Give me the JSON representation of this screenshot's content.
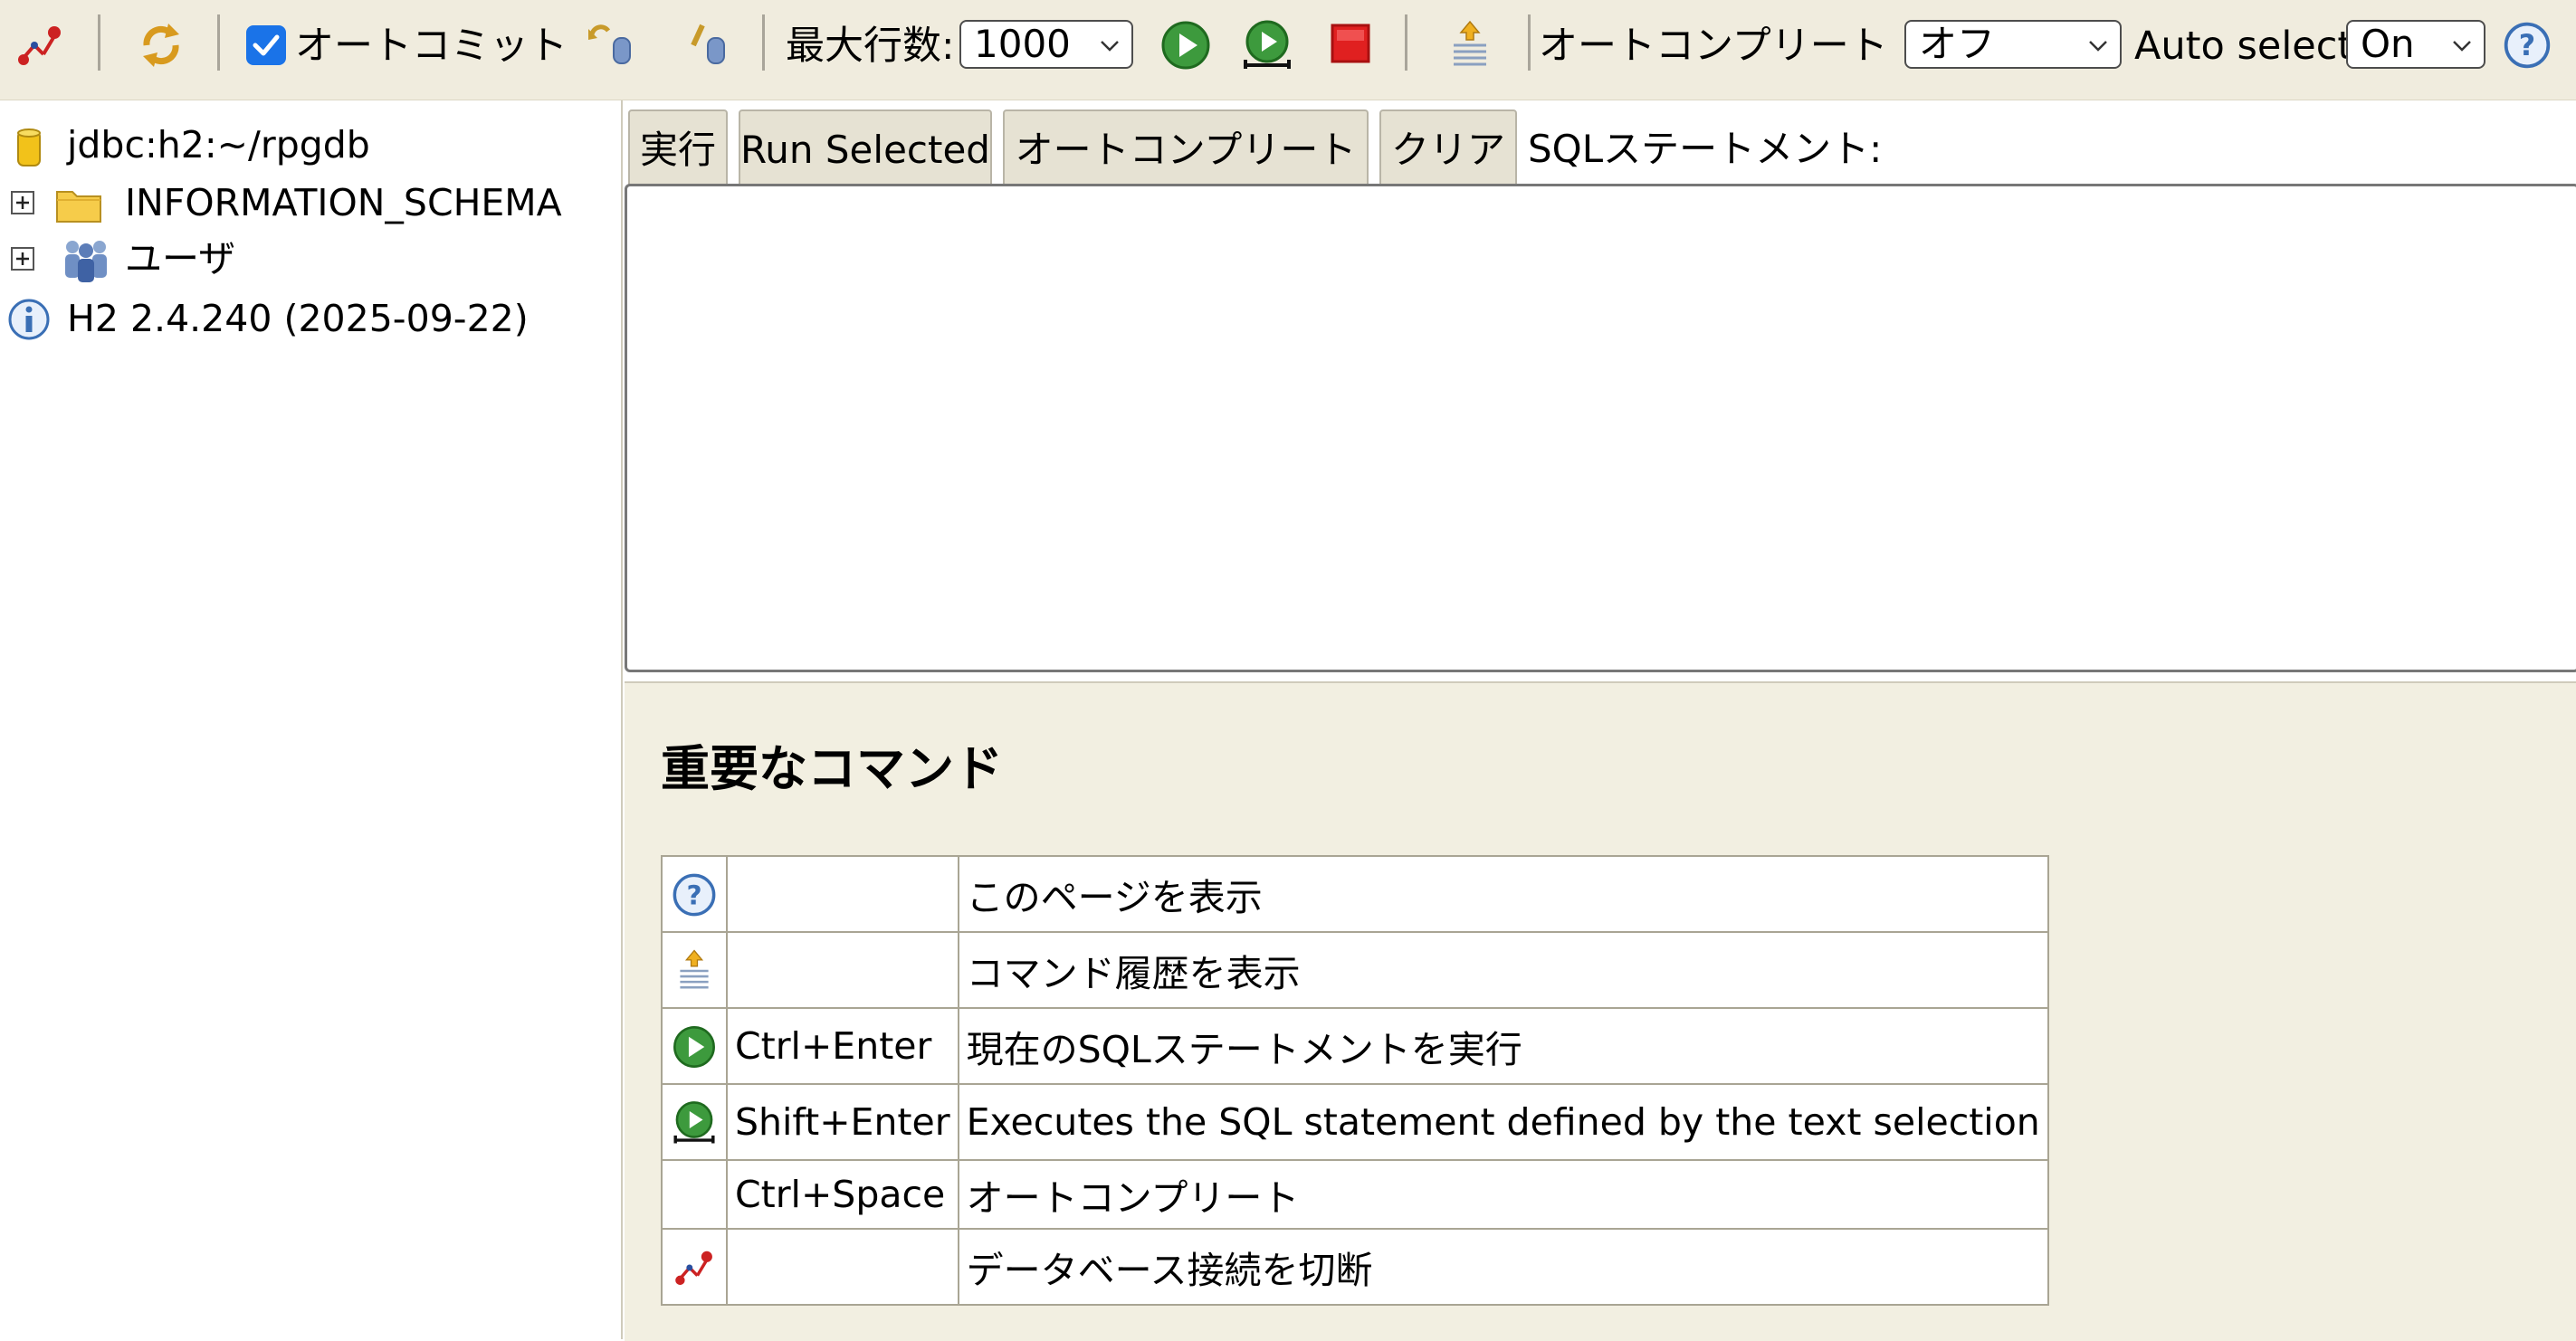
{
  "toolbar": {
    "disconnect_icon": "disconnect-icon",
    "refresh_icon": "refresh-icon",
    "autocommit_checked": true,
    "autocommit_label": "オートコミット",
    "rollback_icon": "rollback-icon",
    "commit_icon": "commit-icon",
    "max_rows_label": "最大行数:",
    "max_rows_value": "1000",
    "run_icon": "run-icon",
    "run_selected_icon": "run-selected-icon",
    "stop_icon": "stop-icon",
    "history_icon": "history-icon",
    "autocomplete_label": "オートコンプリート",
    "autocomplete_value": "オフ",
    "auto_select_label": "Auto select",
    "auto_select_value": "On",
    "help_icon": "help-icon"
  },
  "tree": {
    "connection": "jdbc:h2:~/rpgdb",
    "items": [
      {
        "label": "INFORMATION_SCHEMA",
        "icon": "folder-icon"
      },
      {
        "label": "ユーザ",
        "icon": "users-icon"
      }
    ],
    "version": "H2 2.4.240 (2025-09-22)"
  },
  "editor": {
    "run_label": "実行",
    "run_selected_label": "Run Selected",
    "autocomplete_label": "オートコンプリート",
    "clear_label": "クリア",
    "statement_label": "SQLステートメント:",
    "sql_text": ""
  },
  "help": {
    "title": "重要なコマンド",
    "rows": [
      {
        "icon": "help-icon",
        "key": "",
        "desc": "このページを表示"
      },
      {
        "icon": "history-icon",
        "key": "",
        "desc": "コマンド履歴を表示"
      },
      {
        "icon": "run-icon",
        "key": "Ctrl+Enter",
        "desc": "現在のSQLステートメントを実行"
      },
      {
        "icon": "run-selected-icon",
        "key": "Shift+Enter",
        "desc": "Executes the SQL statement defined by the text selection"
      },
      {
        "icon": "",
        "key": "Ctrl+Space",
        "desc": "オートコンプリート"
      },
      {
        "icon": "disconnect-icon",
        "key": "",
        "desc": "データベース接続を切断"
      }
    ]
  },
  "colors": {
    "toolbar_bg": "#f0ecde",
    "help_bg": "#f2efe1",
    "run_green": "#3d9a3d",
    "stop_red": "#e02020",
    "help_blue": "#3a6fb5"
  }
}
